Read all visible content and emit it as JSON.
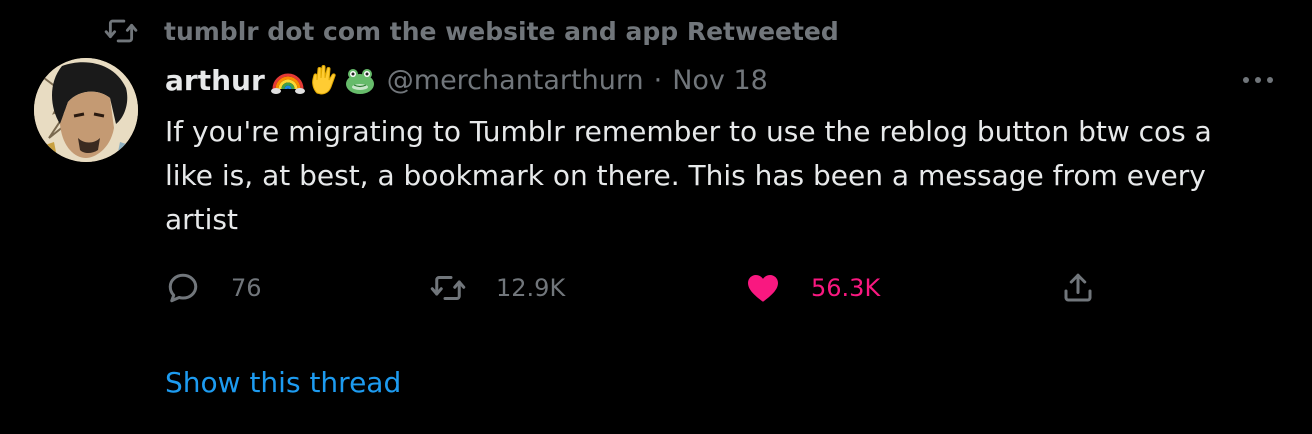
{
  "retweet": {
    "icon": "retweet-icon",
    "text": "tumblr dot com the website and app Retweeted"
  },
  "author": {
    "avatar": "avatar-illustration",
    "display_name": "arthur",
    "name_emojis": [
      "rainbow-emoji",
      "raised-hand-emoji",
      "frog-emoji"
    ],
    "handle": "@merchantarthurn",
    "separator": "·",
    "date": "Nov 18"
  },
  "tweet": {
    "text": "If you're migrating to Tumblr remember to use the reblog button btw cos a\nlike is, at best, a bookmark on there. This has been a message from every\nartist"
  },
  "actions": {
    "reply": {
      "icon": "reply-icon",
      "count": "76"
    },
    "retweet": {
      "icon": "retweet-icon",
      "count": "12.9K"
    },
    "like": {
      "icon": "heart-icon",
      "count": "56.3K",
      "liked": true
    },
    "share": {
      "icon": "share-icon"
    }
  },
  "more": {
    "icon": "more-icon"
  },
  "show_thread": "Show this thread",
  "colors": {
    "background": "#000000",
    "text": "#e7e9ea",
    "muted": "#71767b",
    "link": "#1d9bf0",
    "like": "#f91880"
  }
}
